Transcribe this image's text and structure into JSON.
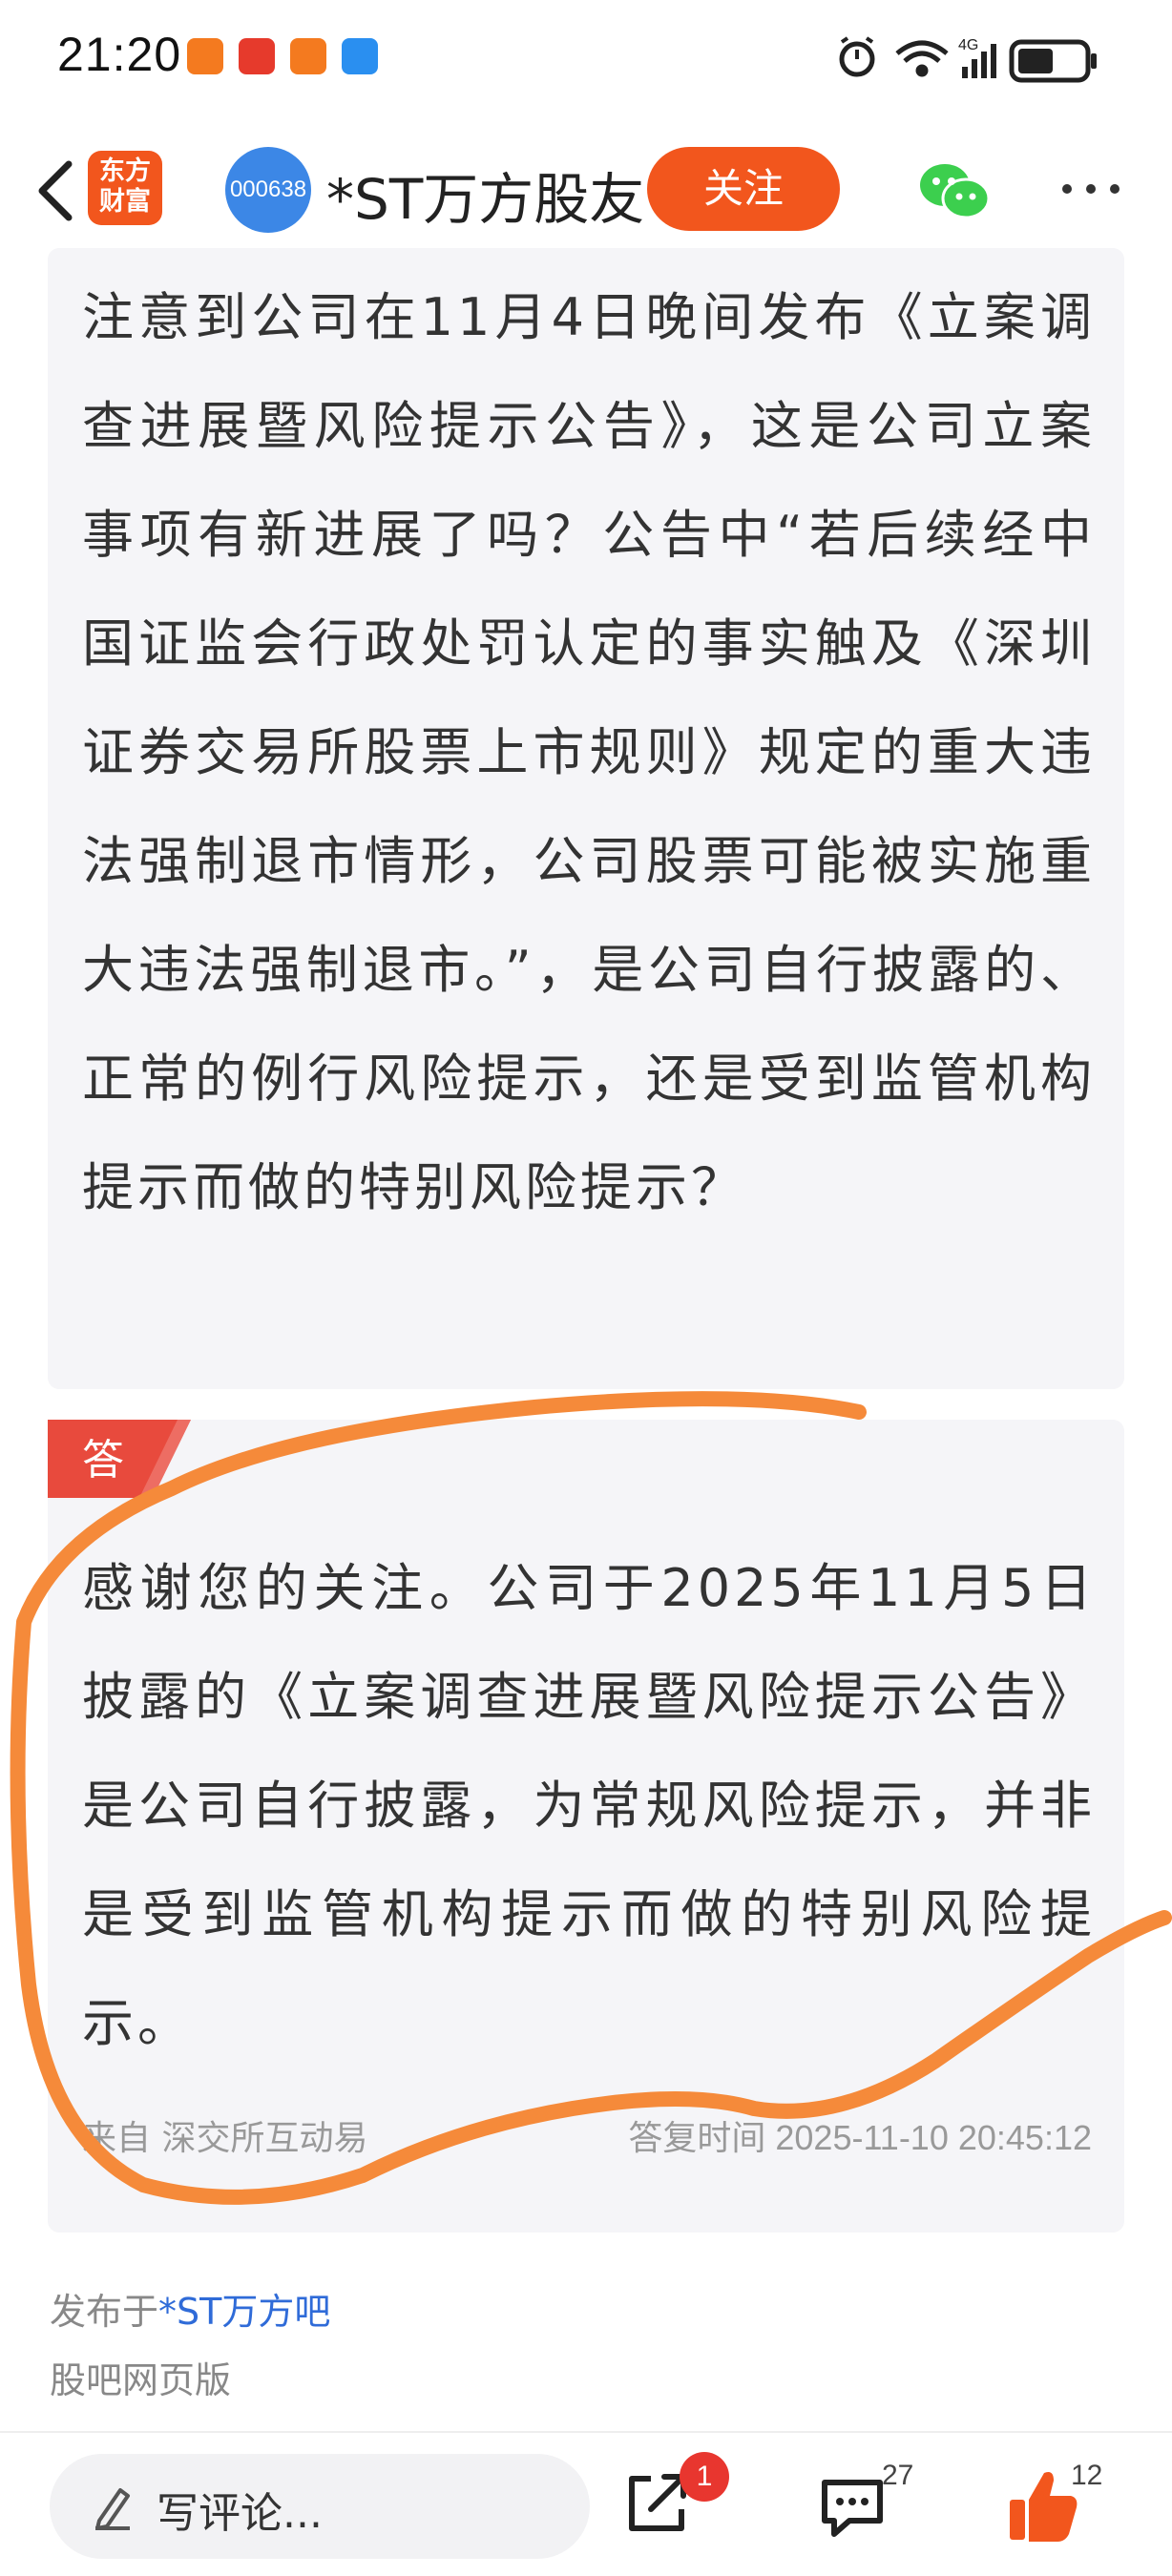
{
  "status_bar": {
    "time": "21:20",
    "network": "4G"
  },
  "nav": {
    "logo_line1": "东方",
    "logo_line2": "财富",
    "stock_code": "000638",
    "title": "*ST万方股友",
    "follow_label": "关注"
  },
  "question": {
    "text": "注意到公司在11月4日晚间发布《立案调查进展暨风险提示公告》，这是公司立案事项有新进展了吗？公告中“若后续经中国证监会行政处罚认定的事实触及《深圳证券交易所股票上市规则》规定的重大违法强制退市情形，公司股票可能被实施重大违法强制退市。”，是公司自行披露的、正常的例行风险提示，还是受到监管机构提示而做的特别风险提示？"
  },
  "answer": {
    "badge": "答",
    "text": "感谢您的关注。公司于2025年11月5日披露的《立案调查进展暨风险提示公告》是公司自行披露，为常规风险提示，并非是受到监管机构提示而做的特别风险提示。",
    "source": "来自 深交所互动易",
    "reply_time": "答复时间 2025-11-10 20:45:12"
  },
  "footer": {
    "posted_prefix": "发布于",
    "posted_link": "*ST万方吧",
    "web_version": "股吧网页版"
  },
  "bottom_bar": {
    "comment_placeholder": "写评论...",
    "share_badge": "1",
    "comment_count": "27",
    "like_count": "12"
  },
  "colors": {
    "brand_orange": "#f2561d",
    "badge_red": "#e84a3d",
    "link_blue": "#2f6bd8",
    "card_bg": "#f5f5f8",
    "annotation_orange": "#f58a3a"
  }
}
